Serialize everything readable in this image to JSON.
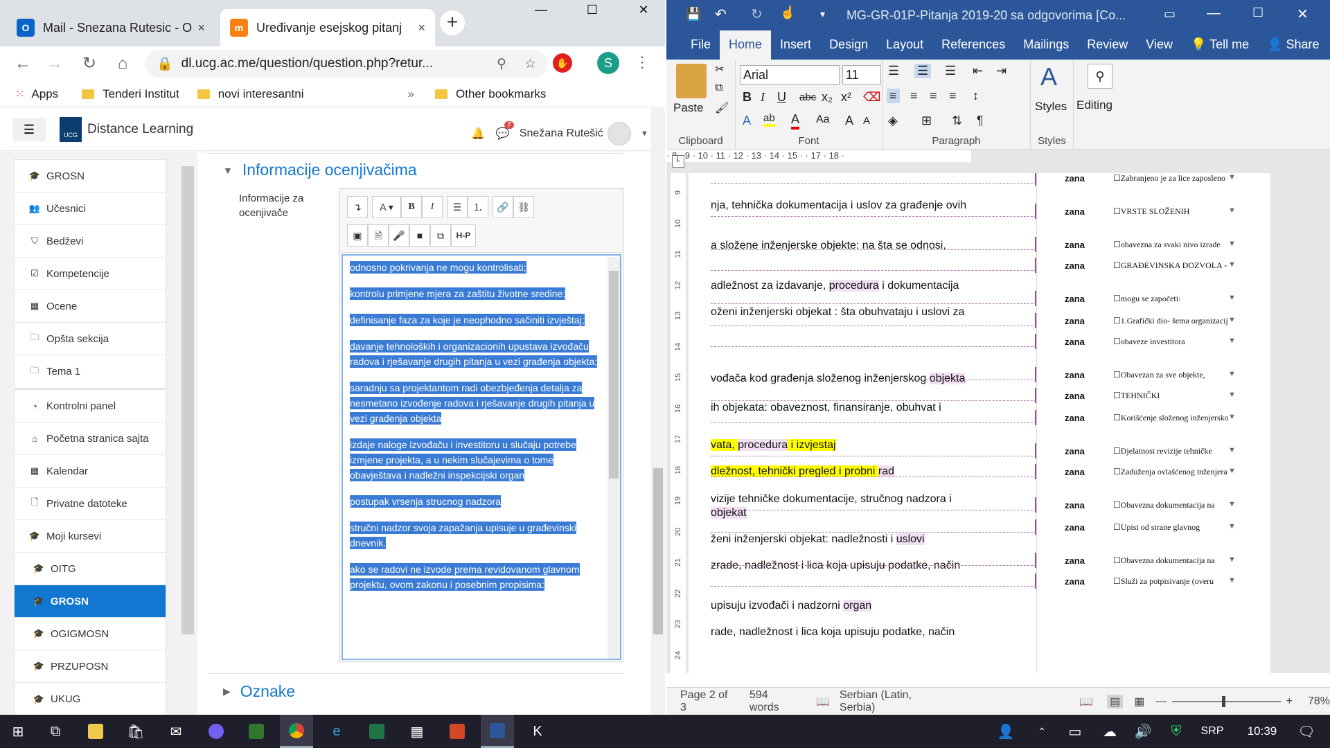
{
  "chrome": {
    "tabs": [
      {
        "label": "Mail - Snezana Rutesic - O",
        "close": "×"
      },
      {
        "label": "Uređivanje esejskog pitanj",
        "close": "×"
      }
    ],
    "new_tab": "+",
    "url": "dl.ucg.ac.me/question/question.php?retur...",
    "profile_initial": "S",
    "bookmarks": [
      {
        "label": "Apps"
      },
      {
        "label": "Tenderi Institut"
      },
      {
        "label": "novi interesantni"
      }
    ],
    "bookmarks_more": "»",
    "other_bookmarks": "Other bookmarks"
  },
  "moodle": {
    "site_name": "Distance Learning",
    "user_name": "Snežana Rutešić",
    "message_count": "7",
    "nav_group1": [
      {
        "label": "GROSN"
      },
      {
        "label": "Učesnici"
      },
      {
        "label": "Bedževi"
      },
      {
        "label": "Kompetencije"
      },
      {
        "label": "Ocene"
      },
      {
        "label": "Opšta sekcija"
      },
      {
        "label": "Tema 1"
      }
    ],
    "nav_group2": [
      {
        "label": "Kontrolni panel"
      },
      {
        "label": "Početna stranica sajta"
      },
      {
        "label": "Kalendar"
      },
      {
        "label": "Privatne datoteke"
      },
      {
        "label": "Moji kursevi"
      },
      {
        "label": "OITG"
      },
      {
        "label": "GROSN"
      },
      {
        "label": "OGIGMOSN"
      },
      {
        "label": "PRZUPOSN"
      },
      {
        "label": "UKUG"
      }
    ],
    "section_title": "Informacije ocenjivačima",
    "field_label": "Informacije za ocenjivače",
    "section2_title": "Oznake",
    "editor_paragraphs": [
      "odnosno pokrivanja ne mogu kontrolisati;",
      "     kontrolu primjene mjera za zaštitu životne sredine;",
      "     definisanje faza za koje je neophodno sačiniti izvještaj;",
      "     davanje tehnoloških i organizacionih upustava izvođaču radova i rješavanje drugih pitanja u vezi građenja objekta;",
      "     saradnju sa projektantom radi obezbjeđenja detalja za nesmetano izvođenje radova i rješavanje drugih pitanja u vezi građenja objekta",
      "     izdaje naloge izvođaču i investitoru u slučaju potrebe izmjene projekta, a u nekim slučajevima o tome obavještava i nadležni inspekcijski organ",
      "     postupak vrsenja strucnog nadzora",
      "     stručni nadzor svoja zapažanja upisuje u građevinski dnevnik.",
      "     ako se radovi ne izvode prema revidovanom glavnom projektu, ovom zakonu i posebnim propisima:"
    ]
  },
  "word": {
    "title": "MG-GR-01P-Pitanja 2019-20 sa odgovorima [Co...",
    "tabs": [
      {
        "label": "File"
      },
      {
        "label": "Home"
      },
      {
        "label": "Insert"
      },
      {
        "label": "Design"
      },
      {
        "label": "Layout"
      },
      {
        "label": "References"
      },
      {
        "label": "Mailings"
      },
      {
        "label": "Review"
      },
      {
        "label": "View"
      },
      {
        "label": "Tell me"
      },
      {
        "label": "Share"
      }
    ],
    "font_name": "Arial",
    "font_size": "11",
    "groups": {
      "clipboard": "Clipboard",
      "font": "Font",
      "paragraph": "Paragraph",
      "styles": "Styles"
    },
    "paste": "Paste",
    "styles_btn": "Styles",
    "editing_btn": "Editing",
    "ruler": "· 8 · 9 · 10 · 11 · 12 · 13 · 14 · 15 ·  · 17 · 18 ·",
    "vruler": [
      "9",
      "10",
      "11",
      "12",
      "13",
      "14",
      "15",
      "16",
      "17",
      "18",
      "19",
      "20",
      "21",
      "22",
      "23",
      "24"
    ],
    "doc_lines": [
      {
        "t": "nja, tehnička dokumentacija  i uslov za građenje ovih"
      },
      {
        "t": "a složene inženjerske objekte: na šta se odnosi,"
      },
      {
        "t": "adležnost za izdavanje,  ",
        "p": "procedura",
        "t2": " i dokumentacija"
      },
      {
        "t": "oženi inženjerski objekat : šta obuhvataju i uslovi za"
      },
      {
        "t": "vođača kod građenja složenog inženjerskog ",
        "p": "objekta"
      },
      {
        "t": "ih objekata: obaveznost, finansiranje, obuhvat i"
      },
      {
        "y1": "vata, ",
        "py": "procedura",
        "y2": " i izvjestaj"
      },
      {
        "y1": "dležnost, tehnički pregled  i probni ",
        "p": "rad"
      },
      {
        "t": "vizije tehničke dokumentacije, stručnog nadzora i"
      },
      {
        "t": " ",
        "p": "objekat"
      },
      {
        "t": "ženi inženjerski objekat: nadležnosti i ",
        "p": "uslovi"
      },
      {
        "t": "zrade, nadležnost i lica koja upisuju podatke, način"
      },
      {
        "t": "upisuju izvođači i nadzorni ",
        "p": "organ"
      },
      {
        "t": "rade, nadležnost i lica koja upisuju podatke, način"
      }
    ],
    "comments": [
      {
        "author": "zana",
        "text": "Zabranjeno je za lice zaposleno u"
      },
      {
        "author": "zana",
        "text": "VRSTE SLOŽENIH"
      },
      {
        "author": "zana",
        "text": "obavezna za svaki nivo izrade"
      },
      {
        "author": "zana",
        "text": "GRAĐEVINSKA DOZVOLA -"
      },
      {
        "author": "zana",
        "text": "mogu se započeti:"
      },
      {
        "author": "zana",
        "text": "1.Grafički dio- šema organizacije"
      },
      {
        "author": "zana",
        "text": "obaveze investitora"
      },
      {
        "author": "zana",
        "text": "Obavezan za sve objekte,"
      },
      {
        "author": "zana",
        "text": "TEHNIČKI"
      },
      {
        "author": "zana",
        "text": "Korišćenje složenog inženjerskog"
      },
      {
        "author": "zana",
        "text": "Djelatnost revizije tehničke"
      },
      {
        "author": "zana",
        "text": "Zaduženja ovlašćenog inženjera"
      },
      {
        "author": "zana",
        "text": "Obavezna dokumentacija na"
      },
      {
        "author": "zana",
        "text": "Upisi od strane glavnog"
      },
      {
        "author": "zana",
        "text": "Obavezna dokumentacija na"
      },
      {
        "author": "zana",
        "text": "Služi za potpisivanje (overu"
      }
    ],
    "status": {
      "page": "Page 2 of 3",
      "words": "594 words",
      "language": "Serbian (Latin, Serbia)",
      "zoom": "78%"
    }
  },
  "taskbar": {
    "lang": "SRP",
    "time": "10:39"
  },
  "colors": {
    "word_blue": "#2b579a",
    "moodle_blue": "#1177d1",
    "selection": "#3a7bd5",
    "taskbar": "#1f1f2b"
  }
}
